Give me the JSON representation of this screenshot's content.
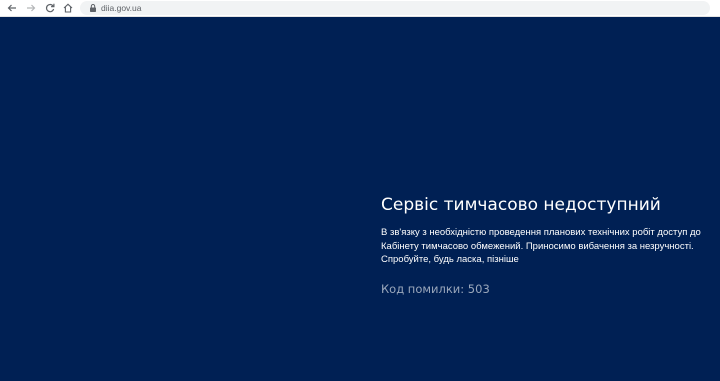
{
  "browser": {
    "url": "diia.gov.ua"
  },
  "main": {
    "title": "Сервіс тимчасово недоступний",
    "message_lines": [
      "В зв'язку з необхідністю проведення планових технічних робіт доступ до",
      "Кабінету тимчасово обмежений. Приносимо вибачення за незручності.",
      "Спробуйте, будь ласка, пізніше"
    ],
    "error_code": "Код помилки: 503"
  },
  "colors": {
    "background": "#002054",
    "text": "#ffffff",
    "muted_text": "#9aa7bb"
  }
}
